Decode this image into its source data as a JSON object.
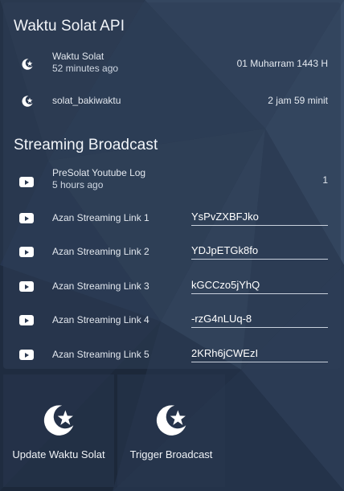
{
  "waktu_solat_api": {
    "title": "Waktu Solat API",
    "rows": [
      {
        "label": "Waktu Solat",
        "sub": "52 minutes ago",
        "value": "01 Muharram 1443 H",
        "icon": "crescent-star-icon"
      },
      {
        "label": "solat_bakiwaktu",
        "value": "2 jam 59 minit",
        "icon": "crescent-star-icon"
      }
    ]
  },
  "streaming_broadcast": {
    "title": "Streaming Broadcast",
    "log": {
      "label": "PreSolat Youtube Log",
      "sub": "5 hours ago",
      "value": "1",
      "icon": "youtube-icon"
    },
    "links": [
      {
        "label": "Azan Streaming Link 1",
        "value": "YsPvZXBFJko"
      },
      {
        "label": "Azan Streaming Link 2",
        "value": "YDJpETGk8fo"
      },
      {
        "label": "Azan Streaming Link 3",
        "value": "kGCCzo5jYhQ"
      },
      {
        "label": "Azan Streaming Link 4",
        "value": "-rzG4nLUq-8"
      },
      {
        "label": "Azan Streaming Link 5",
        "value": "2KRh6jCWEzI"
      }
    ]
  },
  "actions": {
    "update": {
      "label": "Update Waktu Solat",
      "icon": "crescent-star-icon"
    },
    "trigger": {
      "label": "Trigger Broadcast",
      "icon": "crescent-star-icon"
    }
  },
  "colors": {
    "background": "#1d2838",
    "panel": "#2e3e56",
    "text": "#e8edf3",
    "underline": "#c8d0dc"
  }
}
